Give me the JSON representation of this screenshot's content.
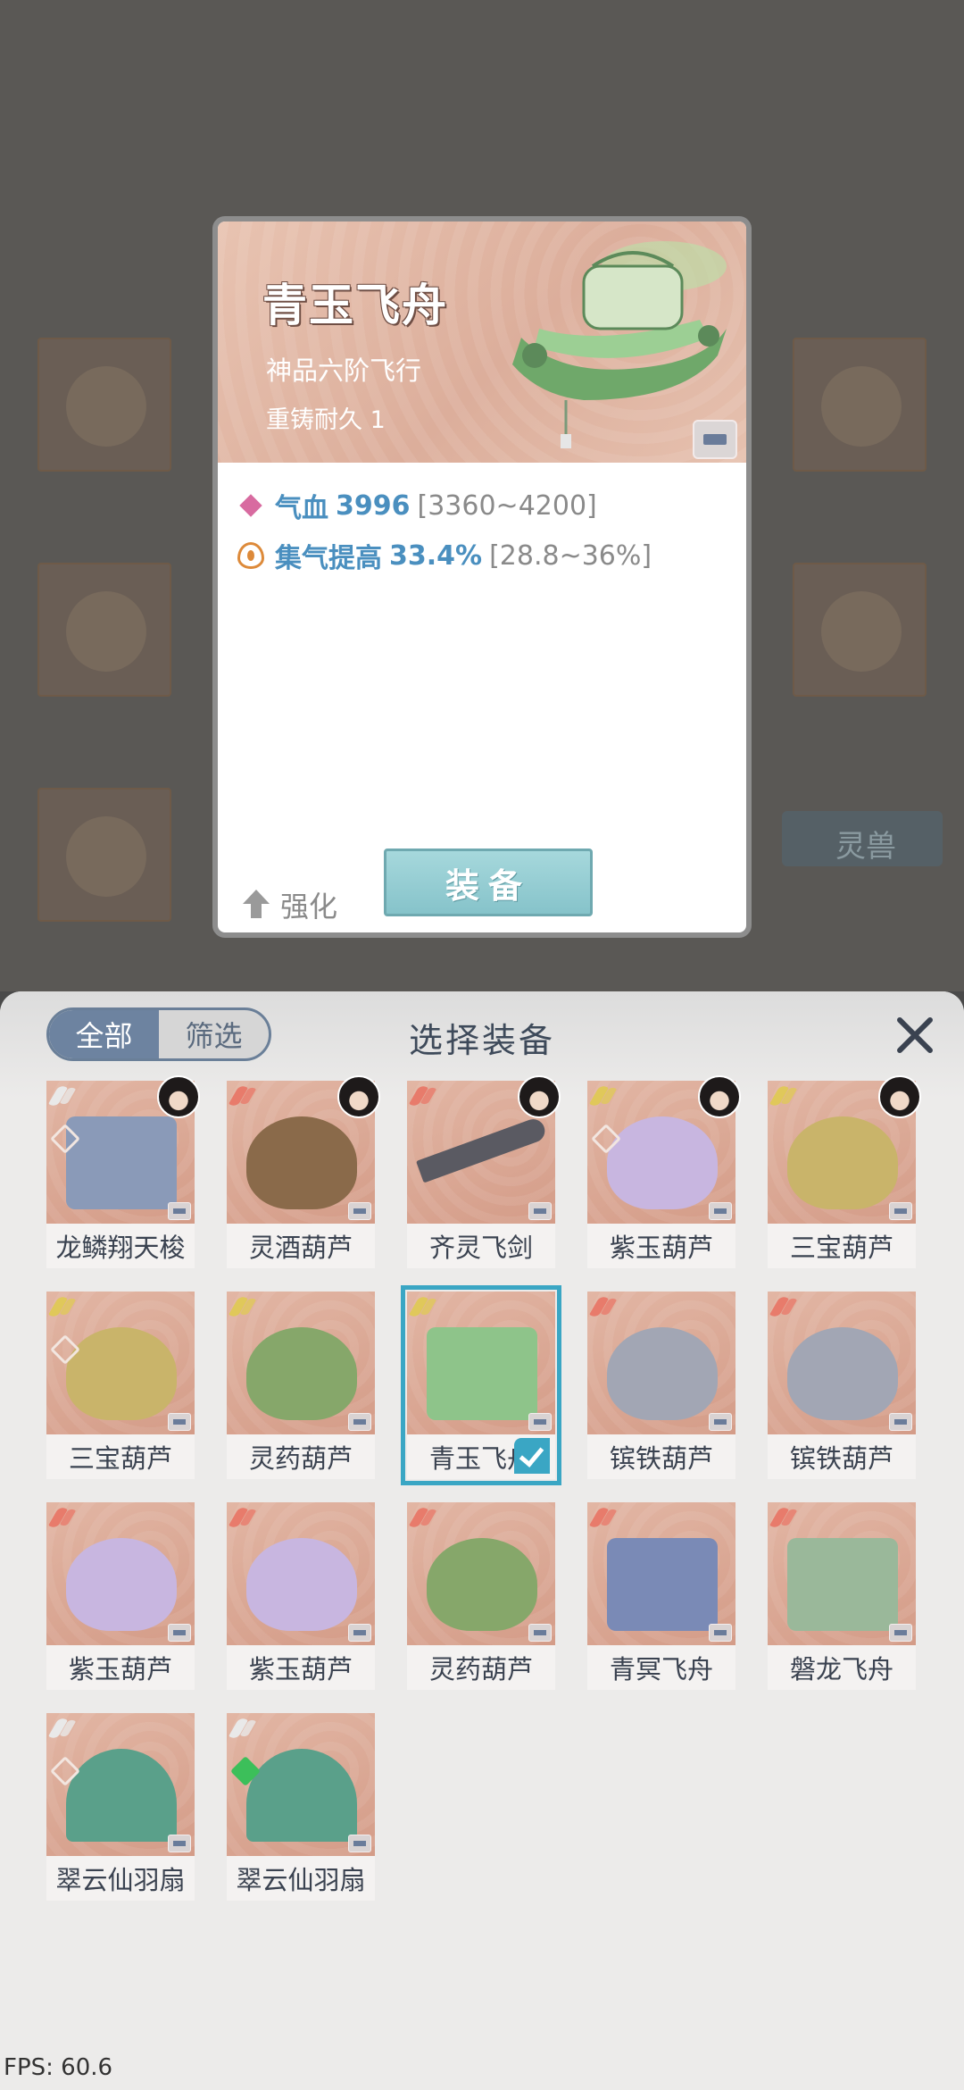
{
  "colors": {
    "accent_blue": "#4a8fbf",
    "selection": "#3aa6c4",
    "button_teal": "#86c3ca",
    "card_bg": "#d49c88"
  },
  "detail": {
    "name": "青玉飞舟",
    "grade": "神品六阶飞行",
    "recast": "重铸耐久 1",
    "stats": [
      {
        "icon": "diamond-icon",
        "name": "气血",
        "value": "3996",
        "range": "[3360~4200]"
      },
      {
        "icon": "flame-icon",
        "name": "集气提高",
        "value": "33.4%",
        "range": "[28.8~36%]"
      }
    ],
    "enhance_label": "强化",
    "equip_label": "装备"
  },
  "background": {
    "tab_label": "灵兽"
  },
  "panel": {
    "title": "选择装备",
    "filter_all": "全部",
    "filter_filter": "筛选"
  },
  "items": [
    {
      "name": "龙鳞翔天梭",
      "wing": "#e9e9e9",
      "set": true,
      "avatar": true,
      "color": "#8a9ab8",
      "shape": "boat"
    },
    {
      "name": "灵酒葫芦",
      "wing": "#e87b6b",
      "set": false,
      "avatar": true,
      "color": "#8a6a4a",
      "shape": "gourd"
    },
    {
      "name": "齐灵飞剑",
      "wing": "#e87b6b",
      "set": false,
      "avatar": true,
      "color": "#5a5a62",
      "shape": "sword"
    },
    {
      "name": "紫玉葫芦",
      "wing": "#e0c85a",
      "set": true,
      "avatar": true,
      "color": "#c8b6e0",
      "shape": "gourd"
    },
    {
      "name": "三宝葫芦",
      "wing": "#e0c85a",
      "set": false,
      "avatar": true,
      "color": "#c9b46a",
      "shape": "gourd"
    },
    {
      "name": "三宝葫芦",
      "wing": "#e0c85a",
      "set": true,
      "avatar": false,
      "color": "#c9b46a",
      "shape": "gourd"
    },
    {
      "name": "灵药葫芦",
      "wing": "#e0c85a",
      "set": false,
      "avatar": false,
      "color": "#86a76a",
      "shape": "gourd"
    },
    {
      "name": "青玉飞舟",
      "wing": "#e0c85a",
      "set": false,
      "avatar": false,
      "color": "#8ec48a",
      "shape": "boat",
      "selected": true
    },
    {
      "name": "镔铁葫芦",
      "wing": "#e87b6b",
      "set": false,
      "avatar": false,
      "color": "#a2a6b4",
      "shape": "gourd"
    },
    {
      "name": "镔铁葫芦",
      "wing": "#e87b6b",
      "set": false,
      "avatar": false,
      "color": "#a2a6b4",
      "shape": "gourd"
    },
    {
      "name": "紫玉葫芦",
      "wing": "#e87b6b",
      "set": false,
      "avatar": false,
      "color": "#c8b6e0",
      "shape": "gourd"
    },
    {
      "name": "紫玉葫芦",
      "wing": "#e87b6b",
      "set": false,
      "avatar": false,
      "color": "#c8b6e0",
      "shape": "gourd"
    },
    {
      "name": "灵药葫芦",
      "wing": "#e87b6b",
      "set": false,
      "avatar": false,
      "color": "#86a76a",
      "shape": "gourd"
    },
    {
      "name": "青冥飞舟",
      "wing": "#e87b6b",
      "set": false,
      "avatar": false,
      "color": "#7a8ab6",
      "shape": "boat"
    },
    {
      "name": "磐龙飞舟",
      "wing": "#e87b6b",
      "set": false,
      "avatar": false,
      "color": "#9ab89a",
      "shape": "boat"
    },
    {
      "name": "翠云仙羽扇",
      "wing": "#e9e9e9",
      "set": true,
      "avatar": false,
      "color": "#5aa08a",
      "shape": "fan"
    },
    {
      "name": "翠云仙羽扇",
      "wing": "#e9e9e9",
      "set": "green",
      "avatar": false,
      "color": "#5aa08a",
      "shape": "fan"
    }
  ],
  "fps": "FPS: 60.6"
}
